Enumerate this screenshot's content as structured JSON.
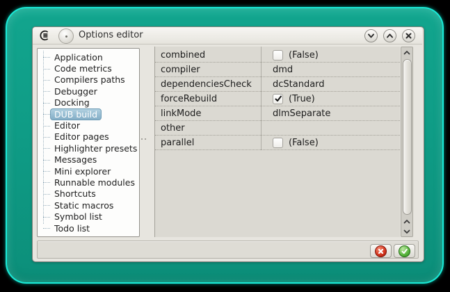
{
  "window": {
    "title": "Options editor",
    "controls": [
      {
        "name": "shade",
        "icon": "chevron-down-icon"
      },
      {
        "name": "unshade",
        "icon": "chevron-up-icon"
      },
      {
        "name": "close",
        "icon": "close-icon"
      }
    ]
  },
  "sidebar": {
    "items": [
      {
        "label": "Application",
        "selected": false
      },
      {
        "label": "Code metrics",
        "selected": false
      },
      {
        "label": "Compilers paths",
        "selected": false
      },
      {
        "label": "Debugger",
        "selected": false
      },
      {
        "label": "Docking",
        "selected": false
      },
      {
        "label": "DUB build",
        "selected": true
      },
      {
        "label": "Editor",
        "selected": false
      },
      {
        "label": "Editor pages",
        "selected": false
      },
      {
        "label": "Highlighter presets",
        "selected": false
      },
      {
        "label": "Messages",
        "selected": false
      },
      {
        "label": "Mini explorer",
        "selected": false
      },
      {
        "label": "Runnable modules",
        "selected": false
      },
      {
        "label": "Shortcuts",
        "selected": false
      },
      {
        "label": "Static macros",
        "selected": false
      },
      {
        "label": "Symbol list",
        "selected": false
      },
      {
        "label": "Todo list",
        "selected": false
      }
    ]
  },
  "properties": {
    "rows": [
      {
        "name": "combined",
        "type": "bool",
        "checked": false,
        "value": "(False)"
      },
      {
        "name": "compiler",
        "type": "text",
        "value": "dmd"
      },
      {
        "name": "dependenciesCheck",
        "type": "text",
        "value": "dcStandard"
      },
      {
        "name": "forceRebuild",
        "type": "bool",
        "checked": true,
        "value": "(True)"
      },
      {
        "name": "linkMode",
        "type": "text",
        "value": "dlmSeparate"
      },
      {
        "name": "other",
        "type": "text",
        "value": ""
      },
      {
        "name": "parallel",
        "type": "bool",
        "checked": false,
        "value": "(False)"
      }
    ]
  },
  "footer": {
    "buttons": [
      {
        "name": "cancel",
        "icon": "red-cross-icon"
      },
      {
        "name": "accept",
        "icon": "green-check-icon"
      }
    ]
  },
  "colors": {
    "desktop": "#000000",
    "frame_fill": "#0f9c86",
    "frame_outline": "#1aead7",
    "selection_blue": "#84aec7",
    "cancel_red": "#d63a22",
    "accept_green": "#57b33c"
  }
}
